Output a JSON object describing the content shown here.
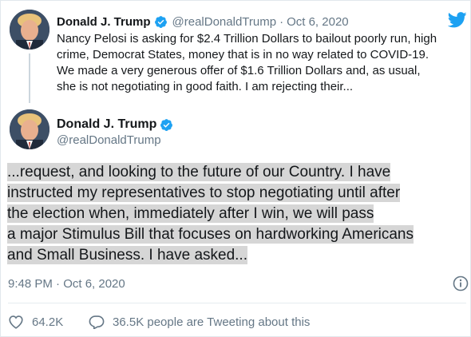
{
  "tweet": {
    "author_name": "Donald J. Trump",
    "author_handle": "@realDonaldTrump",
    "separator": "·",
    "date": "Oct 6, 2020",
    "text": "Nancy Pelosi is asking for $2.4 Trillion Dollars to bailout poorly run, high crime, Democrat States, money that is in no way related to COVID-19. We made a very generous offer of $1.6 Trillion Dollars and, as usual, she is not negotiating in good faith. I am rejecting their..."
  },
  "expanded": {
    "author_name": "Donald J. Trump",
    "author_handle": "@realDonaldTrump",
    "lines": [
      "...request, and looking to the future of our Country. I have",
      "instructed my representatives to stop negotiating until after",
      "the election when, immediately after I win, we will pass",
      "a major Stimulus Bill that focuses on hardworking Americans",
      "and Small Business. I have asked..."
    ],
    "timestamp": "9:48 PM · Oct 6, 2020"
  },
  "actions": {
    "likes": "64.2K",
    "conversation": "36.5K people are Tweeting about this"
  },
  "colors": {
    "twitter_blue": "#1da1f2",
    "secondary_text": "#657786",
    "highlight": "#d6d6d6"
  },
  "icons": {
    "logo": "twitter-bird-icon",
    "verified": "verified-badge-icon",
    "info": "info-icon",
    "like": "heart-icon",
    "reply": "speech-bubble-icon"
  }
}
